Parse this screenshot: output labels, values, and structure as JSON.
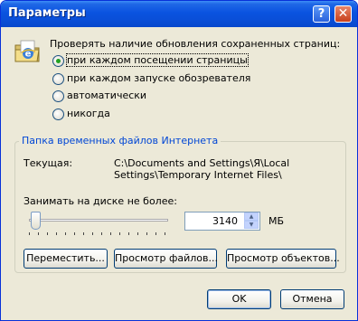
{
  "window": {
    "title": "Параметры",
    "help_label": "?",
    "close_label": "✕"
  },
  "check_section": {
    "label": "Проверять наличие обновления сохраненных страниц:",
    "options": [
      {
        "label": "при каждом посещении страницы",
        "checked": true
      },
      {
        "label": "при каждом запуске обозревателя",
        "checked": false
      },
      {
        "label": "автоматически",
        "checked": false
      },
      {
        "label": "никогда",
        "checked": false
      }
    ]
  },
  "temp_folder": {
    "group_title": "Папка временных файлов Интернета",
    "current_label": "Текущая:",
    "current_path_line1": "C:\\Documents and Settings\\Я\\Local",
    "current_path_line2": "Settings\\Temporary Internet Files\\",
    "disk_label": "Занимать на диске не более:",
    "disk_value": "3140",
    "unit": "МБ",
    "slider_level": 0.07
  },
  "buttons": {
    "move": "Переместить...",
    "view_files": "Просмотр файлов...",
    "view_objects": "Просмотр объектов...",
    "ok": "OK",
    "cancel": "Отмена"
  },
  "colors": {
    "title_bar": "#0a53e0",
    "dialog_bg": "#ece9d8",
    "group_title": "#0046d5",
    "radio_dot": "#21a121"
  },
  "icons": {
    "settings_icon": "folder-with-ie-logo-icon",
    "close": "close-icon",
    "help": "help-icon"
  }
}
